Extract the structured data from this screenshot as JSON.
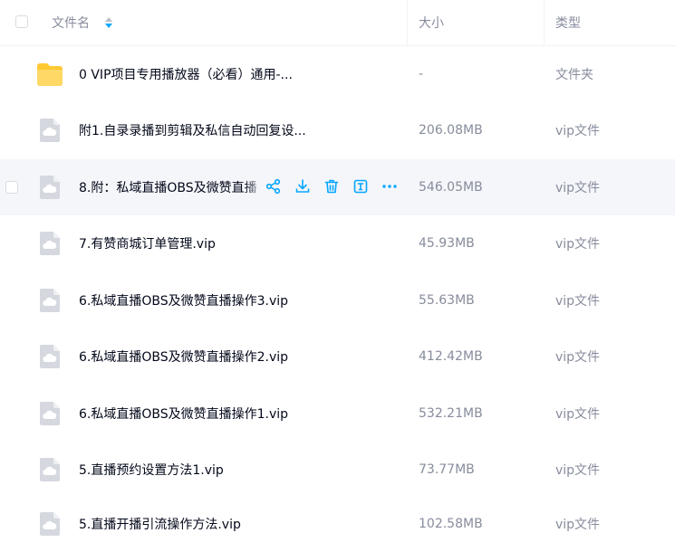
{
  "header": {
    "name_label": "文件名",
    "size_label": "大小",
    "type_label": "类型"
  },
  "rows": [
    {
      "name": "0 VIP项目专用播放器（必看）通用-...",
      "size": "-",
      "type": "文件夹",
      "icon": "folder-icon"
    },
    {
      "name": "附1.自录录播到剪辑及私信自动回复设...",
      "size": "206.08MB",
      "type": "vip文件",
      "icon": "cloud-file-icon"
    },
    {
      "name": "8.附：私域直播OBS及微赞直播",
      "size": "546.05MB",
      "type": "vip文件",
      "icon": "cloud-file-icon"
    },
    {
      "name": "7.有赞商城订单管理.vip",
      "size": "45.93MB",
      "type": "vip文件",
      "icon": "cloud-file-icon"
    },
    {
      "name": "6.私域直播OBS及微赞直播操作3.vip",
      "size": "55.63MB",
      "type": "vip文件",
      "icon": "cloud-file-icon"
    },
    {
      "name": "6.私域直播OBS及微赞直播操作2.vip",
      "size": "412.42MB",
      "type": "vip文件",
      "icon": "cloud-file-icon"
    },
    {
      "name": "6.私域直播OBS及微赞直播操作1.vip",
      "size": "532.21MB",
      "type": "vip文件",
      "icon": "cloud-file-icon"
    },
    {
      "name": "5.直播预约设置方法1.vip",
      "size": "73.77MB",
      "type": "vip文件",
      "icon": "cloud-file-icon"
    },
    {
      "name": "5.直播开播引流操作方法.vip",
      "size": "102.58MB",
      "type": "vip文件",
      "icon": "cloud-file-icon"
    }
  ],
  "hover_actions": [
    "share-icon",
    "download-icon",
    "delete-icon",
    "rename-icon",
    "more-icon"
  ],
  "colors": {
    "accent": "#06a7ff",
    "folder": "#ffc933",
    "file_icon": "#d5d8de",
    "muted_text": "#878c9c",
    "hover_row": "#f5f6fa"
  }
}
